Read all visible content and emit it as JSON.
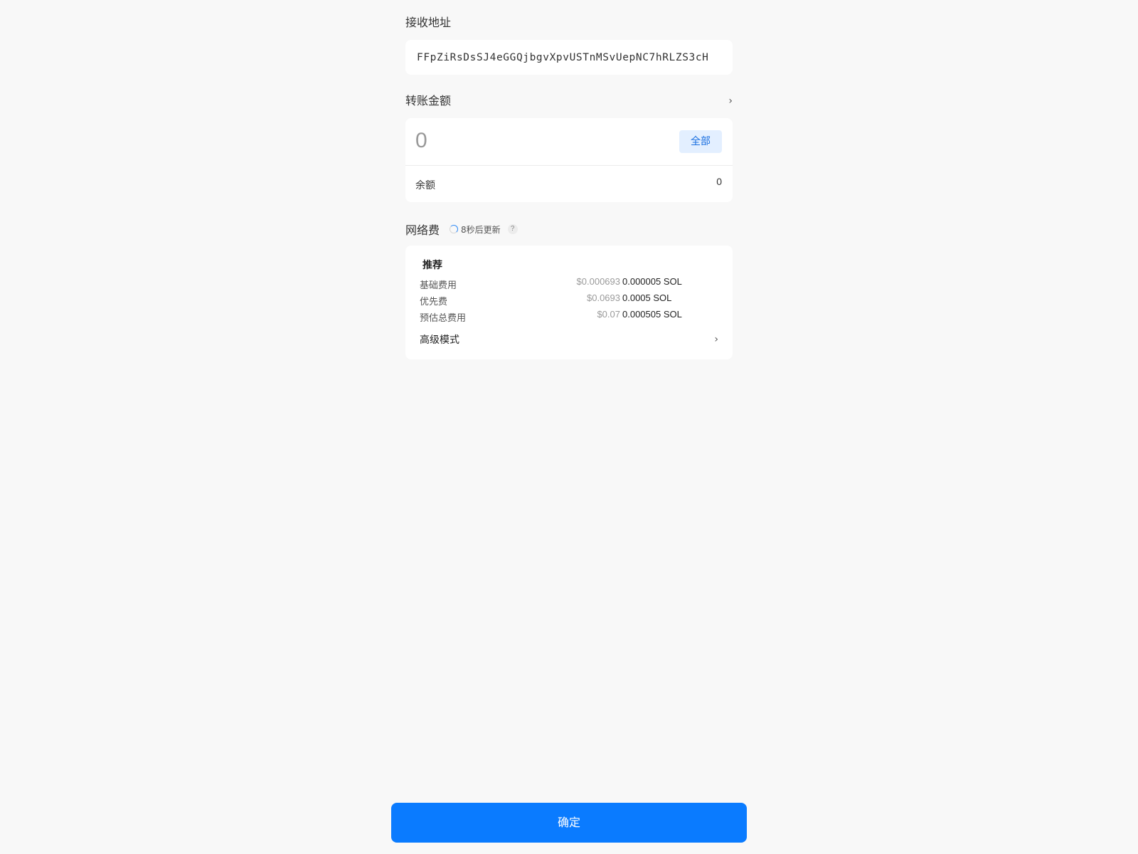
{
  "recipient": {
    "label": "接收地址",
    "address": "FFpZiRsDsSJ4eGGQjbgvXpvUSTnMSvUepNC7hRLZS3cH"
  },
  "amount": {
    "label": "转账金额",
    "chevron": "›",
    "placeholder": "0",
    "max_label": "全部",
    "balance_label": "余额",
    "balance_value": "0"
  },
  "network_fee": {
    "label": "网络费",
    "countdown": "8秒后更新",
    "help": "?",
    "tier_label": "推荐",
    "lines": [
      {
        "label": "基础费用",
        "usd": "$0.000693",
        "sol": "0.000005 SOL"
      },
      {
        "label": "优先费",
        "usd": "$0.0693",
        "sol": "0.0005 SOL"
      },
      {
        "label": "预估总费用",
        "usd": "$0.07",
        "sol": "0.000505 SOL"
      }
    ],
    "advanced_label": "高级模式",
    "advanced_chevron": "›"
  },
  "confirm": {
    "label": "确定"
  },
  "colors": {
    "background": "#f8f8f8",
    "card": "#ffffff",
    "accent": "#0a7bff",
    "max_button_bg": "#e3efff",
    "max_button_text": "#1a6fe0",
    "muted": "#9a9a9a"
  }
}
